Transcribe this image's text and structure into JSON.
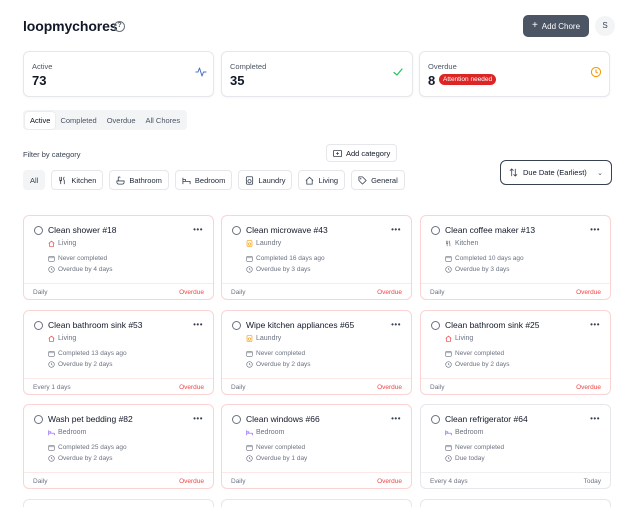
{
  "app": {
    "title": "loopmychores",
    "add_label": "Add Chore",
    "avatar": "S"
  },
  "stats": {
    "active": {
      "label": "Active",
      "value": "73"
    },
    "completed": {
      "label": "Completed",
      "value": "35"
    },
    "overdue": {
      "label": "Overdue",
      "value": "8",
      "badge": "Attention needed"
    }
  },
  "tabs": [
    "Active",
    "Completed",
    "Overdue",
    "All Chores"
  ],
  "filter": {
    "label": "Filter by category",
    "add_category": "Add category",
    "chips": [
      "All",
      "Kitchen",
      "Bathroom",
      "Bedroom",
      "Laundry",
      "Living",
      "General"
    ]
  },
  "sort": {
    "label": "Due Date (Earliest)"
  },
  "chores": [
    {
      "title": "Clean shower #18",
      "category": "Living",
      "completed": "Never completed",
      "due": "Overdue by 4 days",
      "frequency": "Daily",
      "status": "Overdue"
    },
    {
      "title": "Clean microwave #43",
      "category": "Laundry",
      "completed": "Completed 16 days ago",
      "due": "Overdue by 3 days",
      "frequency": "Daily",
      "status": "Overdue"
    },
    {
      "title": "Clean coffee maker #13",
      "category": "Kitchen",
      "completed": "Completed 10 days ago",
      "due": "Overdue by 3 days",
      "frequency": "Daily",
      "status": "Overdue"
    },
    {
      "title": "Clean bathroom sink #53",
      "category": "Living",
      "completed": "Completed 13 days ago",
      "due": "Overdue by 2 days",
      "frequency": "Every 1 days",
      "status": "Overdue"
    },
    {
      "title": "Wipe kitchen appliances #65",
      "category": "Laundry",
      "completed": "Never completed",
      "due": "Overdue by 2 days",
      "frequency": "Daily",
      "status": "Overdue"
    },
    {
      "title": "Clean bathroom sink #25",
      "category": "Living",
      "completed": "Never completed",
      "due": "Overdue by 2 days",
      "frequency": "Daily",
      "status": "Overdue"
    },
    {
      "title": "Wash pet bedding #82",
      "category": "Bedroom",
      "completed": "Completed 25 days ago",
      "due": "Overdue by 2 days",
      "frequency": "Daily",
      "status": "Overdue"
    },
    {
      "title": "Clean windows #66",
      "category": "Bedroom",
      "completed": "Never completed",
      "due": "Overdue by 1 day",
      "frequency": "Daily",
      "status": "Overdue"
    },
    {
      "title": "Clean refrigerator #64",
      "category": "Bedroom",
      "completed": "Never completed",
      "due": "Due today",
      "frequency": "Every 4 days",
      "status": "Today"
    }
  ],
  "colors": {
    "accent": "#4b5563",
    "danger": "#dc2626",
    "overdue_text": "#ef4444",
    "living": "#ef4444",
    "laundry": "#f59e0b",
    "kitchen": "#6b7280",
    "bedroom": "#8b5cf6"
  }
}
